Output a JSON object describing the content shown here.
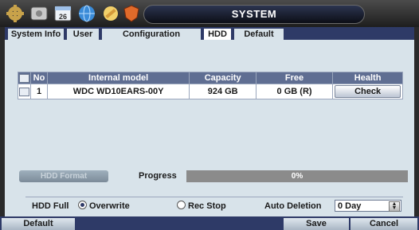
{
  "window": {
    "title": "SYSTEM"
  },
  "toolbar_icons": [
    {
      "name": "gear-icon",
      "color": "#c8a24a"
    },
    {
      "name": "hdd-icon",
      "color": "#c9c9c9"
    },
    {
      "name": "calendar-icon",
      "color": "#9ec0e8"
    },
    {
      "name": "network-globe-icon",
      "color": "#3a8bd8"
    },
    {
      "name": "tools-icon",
      "color": "#d49a3a"
    },
    {
      "name": "shield-icon",
      "color": "#e06a2a"
    }
  ],
  "calendar_day": "26",
  "tabs": [
    {
      "label": "System Info",
      "active": false
    },
    {
      "label": "User",
      "active": false
    },
    {
      "label": "Configuration",
      "active": false
    },
    {
      "label": "HDD",
      "active": true
    },
    {
      "label": "Default",
      "active": false
    }
  ],
  "table": {
    "headers": [
      "No",
      "Internal model",
      "Capacity",
      "Free",
      "Health"
    ],
    "rows": [
      {
        "no": "1",
        "model": "WDC WD10EARS-00Y",
        "capacity": "924 GB",
        "free": "0 GB (R)",
        "health_button": "Check"
      }
    ]
  },
  "format_button": "HDD Format",
  "progress": {
    "label": "Progress",
    "value_text": "0%",
    "value": 0
  },
  "hdd_full": {
    "label": "HDD Full",
    "options": [
      {
        "label": "Overwrite",
        "selected": true
      },
      {
        "label": "Rec Stop",
        "selected": false
      }
    ]
  },
  "auto_deletion": {
    "label": "Auto Deletion",
    "value": "0 Day"
  },
  "footer": {
    "default": "Default",
    "save": "Save",
    "cancel": "Cancel"
  },
  "colors": {
    "accent": "#2e3a67",
    "panel": "#d8e3ea",
    "header": "#5f6e92"
  }
}
